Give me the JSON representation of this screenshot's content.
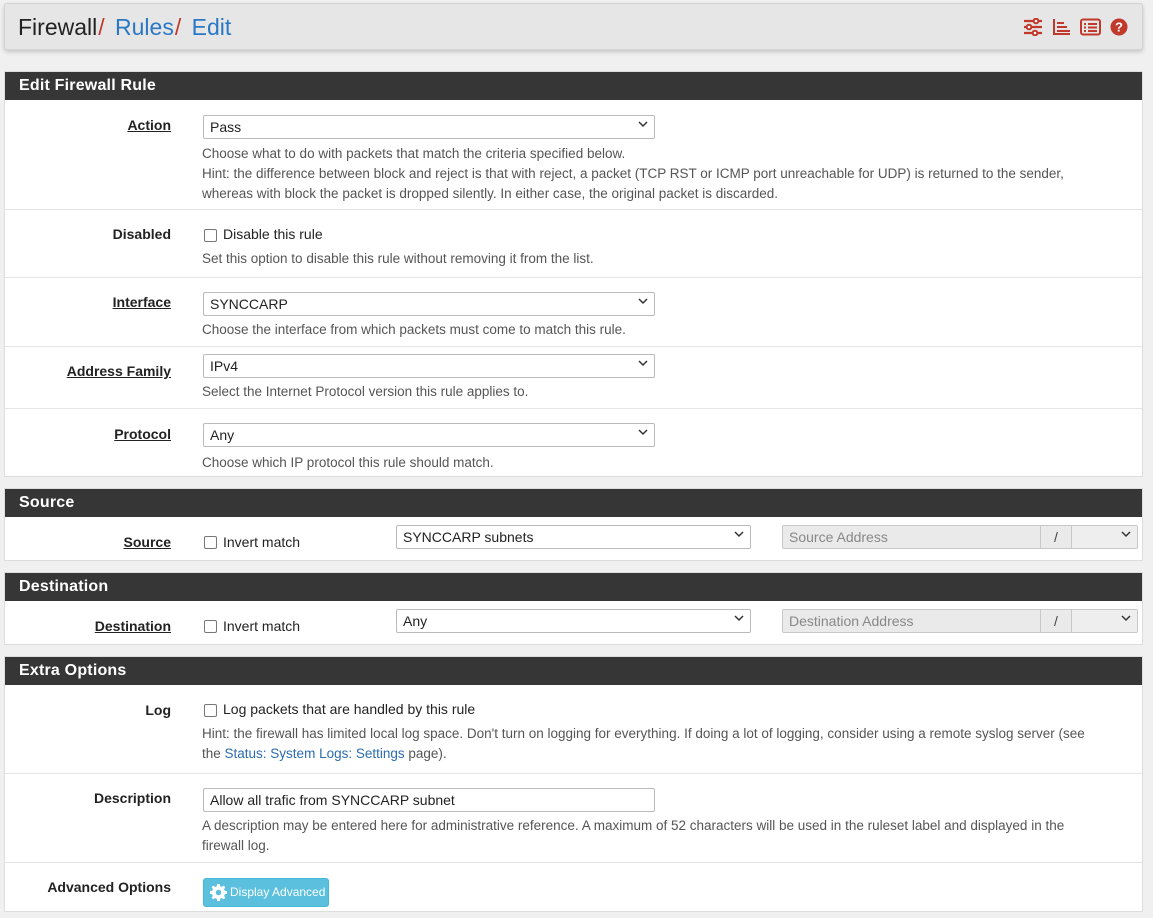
{
  "breadcrumb": {
    "root": "Firewall",
    "sep": "/",
    "rules": "Rules",
    "edit": "Edit"
  },
  "header_icons": [
    "sliders-icon",
    "bar-chart-icon",
    "list-icon",
    "help-icon"
  ],
  "colors": {
    "accent": "#c0392b",
    "link": "#2b78c5",
    "panel_header": "#363636",
    "button_info": "#5bc0de"
  },
  "edit_rule": {
    "title": "Edit Firewall Rule",
    "action": {
      "label": "Action",
      "value": "Pass",
      "help1": "Choose what to do with packets that match the criteria specified below.",
      "help2": "Hint: the difference between block and reject is that with reject, a packet (TCP RST or ICMP port unreachable for UDP) is returned to the sender,",
      "help3": "whereas with block the packet is dropped silently. In either case, the original packet is discarded."
    },
    "disabled": {
      "label": "Disabled",
      "checkbox": "Disable this rule",
      "checked": false,
      "help": "Set this option to disable this rule without removing it from the list."
    },
    "interface": {
      "label": "Interface",
      "value": "SYNCCARP",
      "help": "Choose the interface from which packets must come to match this rule."
    },
    "address_family": {
      "label": "Address Family",
      "value": "IPv4",
      "help": "Select the Internet Protocol version this rule applies to."
    },
    "protocol": {
      "label": "Protocol",
      "value": "Any",
      "help": "Choose which IP protocol this rule should match."
    }
  },
  "source": {
    "title": "Source",
    "label": "Source",
    "invert": "Invert match",
    "checked": false,
    "type": "SYNCCARP subnets",
    "address_placeholder": "Source Address",
    "slash": "/"
  },
  "destination": {
    "title": "Destination",
    "label": "Destination",
    "invert": "Invert match",
    "checked": false,
    "type": "Any",
    "address_placeholder": "Destination Address",
    "slash": "/"
  },
  "extra": {
    "title": "Extra Options",
    "log": {
      "label": "Log",
      "checkbox": "Log packets that are handled by this rule",
      "checked": false,
      "help1": "Hint: the firewall has limited local log space. Don't turn on logging for everything. If doing a lot of logging, consider using a remote syslog server (see",
      "help2_pre": "the ",
      "help2_link": "Status: System Logs: Settings",
      "help2_post": " page)."
    },
    "description": {
      "label": "Description",
      "value": "Allow all trafic from SYNCCARP subnet",
      "help1": "A description may be entered here for administrative reference. A maximum of 52 characters will be used in the ruleset label and displayed in the",
      "help2": "firewall log."
    },
    "advanced": {
      "label": "Advanced Options",
      "button": "Display Advanced"
    }
  }
}
